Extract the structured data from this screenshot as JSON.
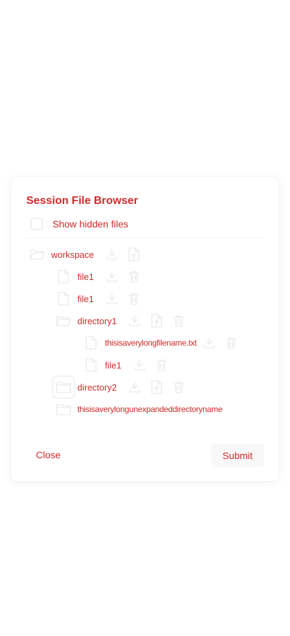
{
  "dialog": {
    "title": "Session File Browser",
    "show_hidden_label": "Show hidden files",
    "show_hidden_checked": false,
    "close_label": "Close",
    "submit_label": "Submit"
  },
  "tree": {
    "workspace": "workspace",
    "file1": "file1",
    "file2": "file1",
    "directory1": "directory1",
    "long_file": "thisisaverylongfilename.txt",
    "dir1_file": "file1",
    "directory2": "directory2",
    "long_dir": "thisisaverylongunexpandeddirectoryname"
  },
  "colors": {
    "text": "#d42a2a",
    "icon": "#ededed"
  }
}
